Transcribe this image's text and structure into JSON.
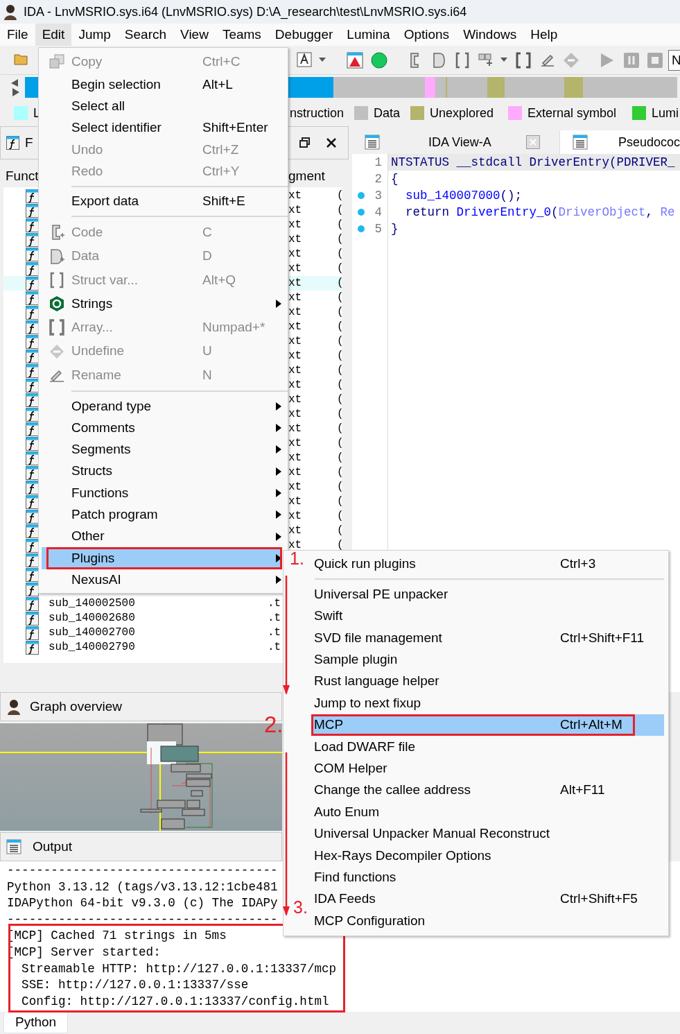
{
  "window": {
    "title": "IDA - LnvMSRIO.sys.i64 (LnvMSRIO.sys) D:\\A_research\\test\\LnvMSRIO.sys.i64"
  },
  "menu_bar": [
    {
      "label": "File",
      "selected": false
    },
    {
      "label": "Edit",
      "selected": true
    },
    {
      "label": "Jump",
      "selected": false
    },
    {
      "label": "Search",
      "selected": false
    },
    {
      "label": "View",
      "selected": false
    },
    {
      "label": "Teams",
      "selected": false
    },
    {
      "label": "Debugger",
      "selected": false
    },
    {
      "label": "Lumina",
      "selected": false
    },
    {
      "label": "Options",
      "selected": false
    },
    {
      "label": "Windows",
      "selected": false
    },
    {
      "label": "Help",
      "selected": false
    }
  ],
  "toolbar": {
    "field_value": "N"
  },
  "legend": [
    {
      "label": "L",
      "color": "#aaffff"
    },
    {
      "label": "nstruction"
    },
    {
      "label": "Data",
      "color": "#c0c0c0"
    },
    {
      "label": "Unexplored",
      "color": "#b4b46c"
    },
    {
      "label": "External symbol",
      "color": "#ffaaff"
    },
    {
      "label": "Lumi",
      "color": "#33cc33"
    }
  ],
  "functions_panel": {
    "title": "F",
    "columns": [
      "Funct",
      "gment"
    ],
    "rows": [
      {
        "segment": "xt",
        "column_3": "(",
        "selected": false
      },
      {
        "segment": "xt",
        "column_3": "(",
        "selected": false
      },
      {
        "segment": "xt",
        "column_3": "(",
        "selected": false
      },
      {
        "segment": "xt",
        "column_3": "(",
        "selected": false
      },
      {
        "segment": "xt",
        "column_3": "(",
        "selected": false
      },
      {
        "segment": "xt",
        "column_3": "(",
        "selected": false
      },
      {
        "segment": "xt",
        "column_3": "(",
        "selected": true
      },
      {
        "segment": "xt",
        "column_3": "(",
        "selected": false
      },
      {
        "segment": "xt",
        "column_3": "(",
        "selected": false
      },
      {
        "segment": "xt",
        "column_3": "(",
        "selected": false
      },
      {
        "segment": "xt",
        "column_3": "(",
        "selected": false
      },
      {
        "segment": "xt",
        "column_3": "(",
        "selected": false
      },
      {
        "segment": "xt",
        "column_3": "(",
        "selected": false
      },
      {
        "segment": "xt",
        "column_3": "(",
        "selected": false
      },
      {
        "segment": "xt",
        "column_3": "(",
        "selected": false
      },
      {
        "segment": "xt",
        "column_3": "(",
        "selected": false
      },
      {
        "segment": "xt",
        "column_3": "(",
        "selected": false
      },
      {
        "segment": "xt",
        "column_3": "(",
        "selected": false
      },
      {
        "segment": "xt",
        "column_3": "(",
        "selected": false
      },
      {
        "segment": "xt",
        "column_3": "(",
        "selected": false
      },
      {
        "segment": "xt",
        "column_3": "(",
        "selected": false
      },
      {
        "segment": "xt",
        "column_3": "(",
        "selected": false
      },
      {
        "segment": "xt",
        "column_3": "(",
        "selected": false
      },
      {
        "segment": "xt",
        "column_3": "(",
        "selected": false
      },
      {
        "segment": "xt",
        "column_3": "(",
        "selected": false
      },
      {
        "selected": false
      },
      {
        "selected": false
      },
      {
        "selected": false
      },
      {
        "name": "sub_140002500",
        "segment": ".t",
        "selected": false
      },
      {
        "name": "sub_140002680",
        "segment": ".t",
        "selected": false
      },
      {
        "name": "sub_140002700",
        "segment": ".t",
        "selected": false
      },
      {
        "name": "sub_140002790",
        "segment": ".t",
        "selected": false
      }
    ]
  },
  "tabs": [
    {
      "label": "IDA View-A",
      "selected": false
    },
    {
      "label": "Pseudococ",
      "selected": true
    }
  ],
  "code": [
    {
      "number": "1",
      "marker": false,
      "highlighted": true,
      "tokens": [
        {
          "text": "NTSTATUS __stdcall DriverEntry(PDRIVER_",
          "kind": "plain"
        }
      ]
    },
    {
      "number": "2",
      "marker": false,
      "highlighted": false,
      "tokens": [
        {
          "text": "{",
          "kind": "plain"
        }
      ]
    },
    {
      "number": "3",
      "marker": true,
      "highlighted": false,
      "indented": true,
      "tokens": [
        {
          "text": "sub_140007000",
          "kind": "func"
        },
        {
          "text": "();",
          "kind": "plain"
        }
      ]
    },
    {
      "number": "4",
      "marker": true,
      "highlighted": false,
      "indented": true,
      "tokens": [
        {
          "text": "return ",
          "kind": "plain"
        },
        {
          "text": "DriverEntry_0",
          "kind": "func"
        },
        {
          "text": "(",
          "kind": "plain"
        },
        {
          "text": "DriverObject",
          "kind": "var"
        },
        {
          "text": ", ",
          "kind": "plain"
        },
        {
          "text": "Re",
          "kind": "var"
        }
      ]
    },
    {
      "number": "5",
      "marker": true,
      "highlighted": false,
      "tokens": [
        {
          "text": "}",
          "kind": "plain"
        }
      ]
    }
  ],
  "graph_overview": {
    "title": "Graph overview"
  },
  "output": {
    "title": "Output",
    "lines": [
      "-------------------------------------",
      "Python 3.13.12 (tags/v3.13.12:1cbe481",
      "IDAPython 64-bit v9.3.0 (c) The IDAPy",
      "-------------------------------------",
      "[MCP] Cached 71 strings in 5ms",
      "[MCP] Server started:",
      "  Streamable HTTP: http://127.0.0.1:13337/mcp",
      "  SSE: http://127.0.0.1:13337/sse",
      "  Config: http://127.0.0.1:13337/config.html"
    ]
  },
  "bottom_tabs": [
    {
      "label": "Python",
      "selected": true
    }
  ],
  "edit_menu": [
    {
      "kind": "copy",
      "label": "Copy",
      "shortcut": "Ctrl+C",
      "disabled": true,
      "selected": false
    },
    {
      "kind": "plain",
      "label": "Begin selection",
      "shortcut": "Alt+L",
      "disabled": false,
      "selected": false
    },
    {
      "kind": "plain",
      "label": "Select all",
      "disabled": false,
      "selected": false
    },
    {
      "kind": "plain",
      "label": "Select identifier",
      "shortcut": "Shift+Enter",
      "disabled": false,
      "selected": false
    },
    {
      "kind": "plain",
      "label": "Undo",
      "shortcut": "Ctrl+Z",
      "disabled": true,
      "selected": false
    },
    {
      "kind": "plain",
      "label": "Redo",
      "shortcut": "Ctrl+Y",
      "disabled": true,
      "selected": false
    },
    {
      "kind": "separator"
    },
    {
      "kind": "plain",
      "label": "Export data",
      "shortcut": "Shift+E",
      "disabled": false,
      "selected": false
    },
    {
      "kind": "separator"
    },
    {
      "kind": "code",
      "label": "Code",
      "shortcut": "C",
      "disabled": true,
      "selected": false
    },
    {
      "kind": "data",
      "label": "Data",
      "shortcut": "D",
      "disabled": true,
      "selected": false
    },
    {
      "kind": "struct",
      "label": "Struct var...",
      "shortcut": "Alt+Q",
      "disabled": true,
      "selected": false
    },
    {
      "kind": "strings",
      "label": "Strings",
      "submenu": true,
      "disabled": false,
      "selected": false
    },
    {
      "kind": "array",
      "label": "Array...",
      "shortcut": "Numpad+*",
      "disabled": true,
      "selected": false
    },
    {
      "kind": "undefine",
      "label": "Undefine",
      "shortcut": "U",
      "disabled": true,
      "selected": false
    },
    {
      "kind": "rename",
      "label": "Rename",
      "shortcut": "N",
      "disabled": true,
      "selected": false
    },
    {
      "kind": "separator"
    },
    {
      "kind": "plain",
      "label": "Operand type",
      "submenu": true,
      "disabled": false,
      "selected": false
    },
    {
      "kind": "plain",
      "label": "Comments",
      "submenu": true,
      "disabled": false,
      "selected": false
    },
    {
      "kind": "plain",
      "label": "Segments",
      "submenu": true,
      "disabled": false,
      "selected": false
    },
    {
      "kind": "plain",
      "label": "Structs",
      "submenu": true,
      "disabled": false,
      "selected": false
    },
    {
      "kind": "plain",
      "label": "Functions",
      "submenu": true,
      "disabled": false,
      "selected": false
    },
    {
      "kind": "plain",
      "label": "Patch program",
      "submenu": true,
      "disabled": false,
      "selected": false
    },
    {
      "kind": "plain",
      "label": "Other",
      "submenu": true,
      "disabled": false,
      "selected": false
    },
    {
      "kind": "plain",
      "label": "Plugins",
      "submenu": true,
      "disabled": false,
      "selected": true
    },
    {
      "kind": "plain",
      "label": "NexusAI",
      "submenu": true,
      "disabled": false,
      "selected": false
    }
  ],
  "plugins_menu": [
    {
      "kind": "item",
      "label": "Quick run plugins",
      "shortcut": "Ctrl+3",
      "selected": false
    },
    {
      "kind": "separator"
    },
    {
      "kind": "item",
      "label": "Universal PE unpacker",
      "selected": false
    },
    {
      "kind": "item",
      "label": "Swift",
      "selected": false
    },
    {
      "kind": "item",
      "label": "SVD file management",
      "shortcut": "Ctrl+Shift+F11",
      "selected": false
    },
    {
      "kind": "item",
      "label": "Sample plugin",
      "selected": false
    },
    {
      "kind": "item",
      "label": "Rust language helper",
      "selected": false
    },
    {
      "kind": "item",
      "label": "Jump to next fixup",
      "selected": false
    },
    {
      "kind": "item",
      "label": "MCP",
      "shortcut": "Ctrl+Alt+M",
      "selected": true
    },
    {
      "kind": "item",
      "label": "Load DWARF file",
      "selected": false
    },
    {
      "kind": "item",
      "label": "COM Helper",
      "selected": false
    },
    {
      "kind": "item",
      "label": "Change the callee address",
      "shortcut": "Alt+F11",
      "selected": false
    },
    {
      "kind": "item",
      "label": "Auto Enum",
      "selected": false
    },
    {
      "kind": "item",
      "label": "Universal Unpacker Manual Reconstruct",
      "selected": false
    },
    {
      "kind": "item",
      "label": "Hex-Rays Decompiler Options",
      "selected": false
    },
    {
      "kind": "item",
      "label": "Find functions",
      "selected": false
    },
    {
      "kind": "item",
      "label": "IDA Feeds",
      "shortcut": "Ctrl+Shift+F5",
      "selected": false
    },
    {
      "kind": "item",
      "label": "MCP Configuration",
      "selected": false
    }
  ],
  "annotations": [
    {
      "label": "1."
    },
    {
      "label": "2."
    },
    {
      "label": "3."
    }
  ]
}
